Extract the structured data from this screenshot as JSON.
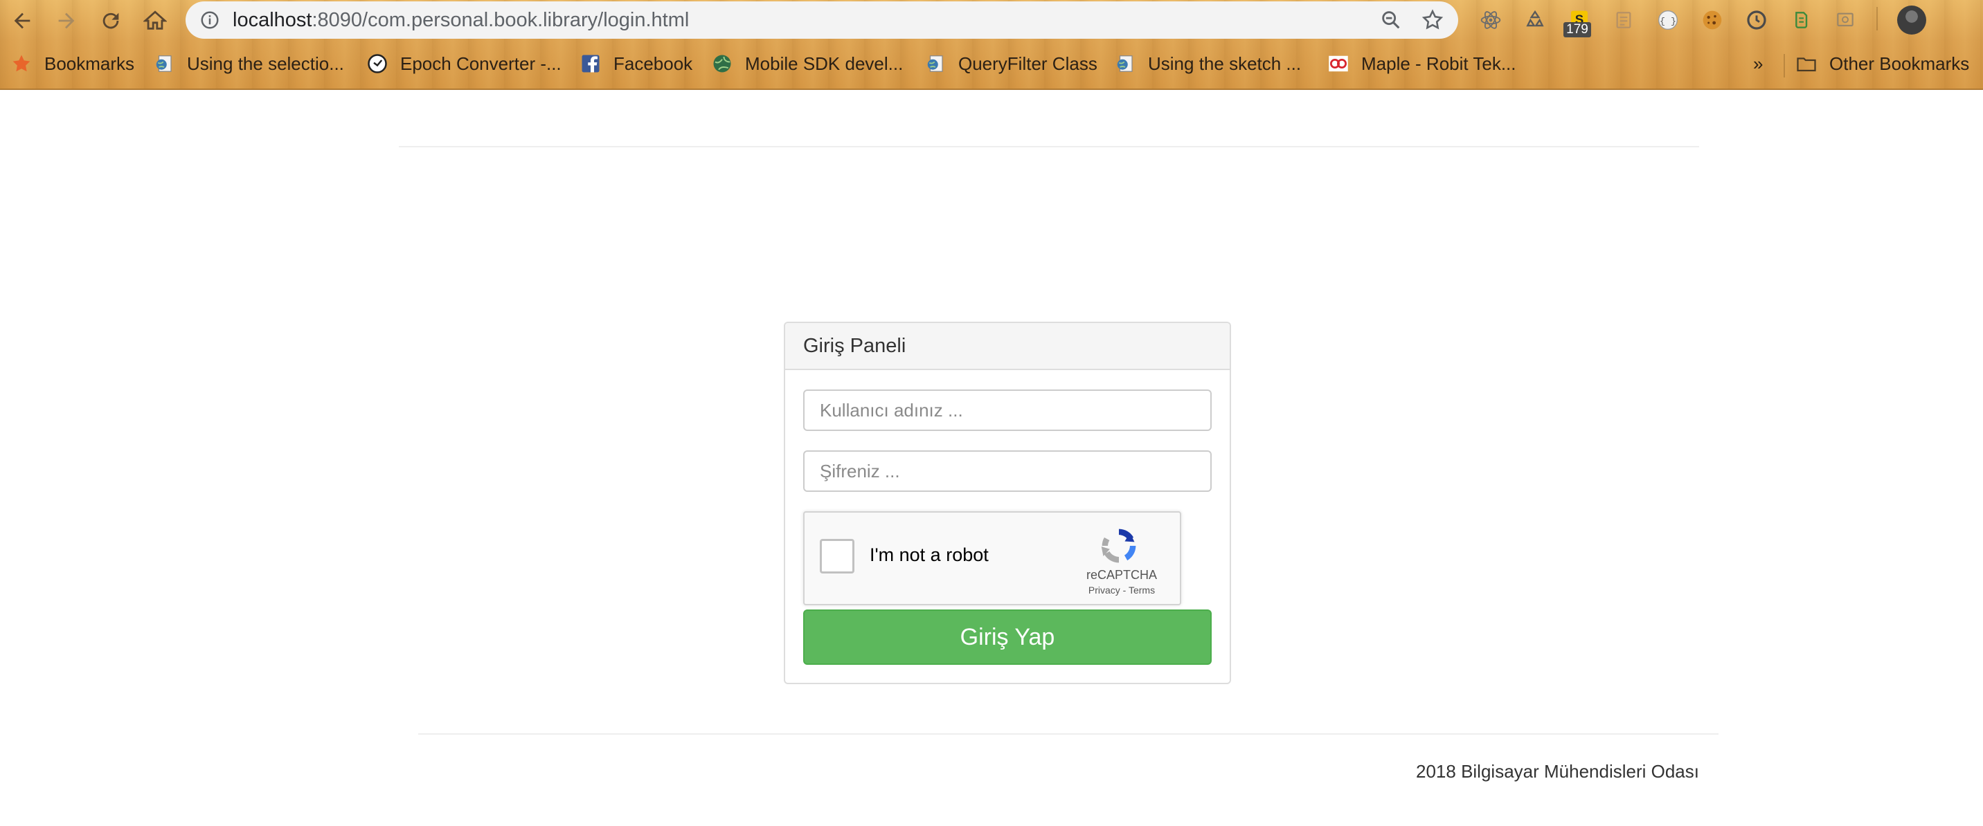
{
  "browser": {
    "url_host": "localhost",
    "url_path": ":8090/com.personal.book.library/login.html",
    "extension_badge": "179",
    "bookmarks": [
      {
        "label": "Bookmarks",
        "icon": "star-icon"
      },
      {
        "label": "Using the selectio...",
        "icon": "globe-page-icon"
      },
      {
        "label": "Epoch Converter -...",
        "icon": "clock-icon"
      },
      {
        "label": "Facebook",
        "icon": "facebook-icon"
      },
      {
        "label": "Mobile SDK devel...",
        "icon": "globe-icon"
      },
      {
        "label": "QueryFilter Class",
        "icon": "globe-page-icon"
      },
      {
        "label": "Using the sketch ...",
        "icon": "globe-page-icon"
      },
      {
        "label": "Maple - Robit Tek...",
        "icon": "infinity-icon"
      }
    ],
    "overflow_label": "»",
    "other_bookmarks": "Other Bookmarks"
  },
  "login_panel": {
    "title": "Giriş Paneli",
    "username_placeholder": "Kullanıcı adınız ...",
    "password_placeholder": "Şifreniz ...",
    "captcha": {
      "label": "I'm not a robot",
      "brand": "reCAPTCHA",
      "links": "Privacy - Terms"
    },
    "submit_label": "Giriş Yap"
  },
  "footer": {
    "text": "2018 Bilgisayar Mühendisleri Odası"
  },
  "colors": {
    "submit_green": "#5cb85c",
    "chrome_wood": "#dca150"
  }
}
